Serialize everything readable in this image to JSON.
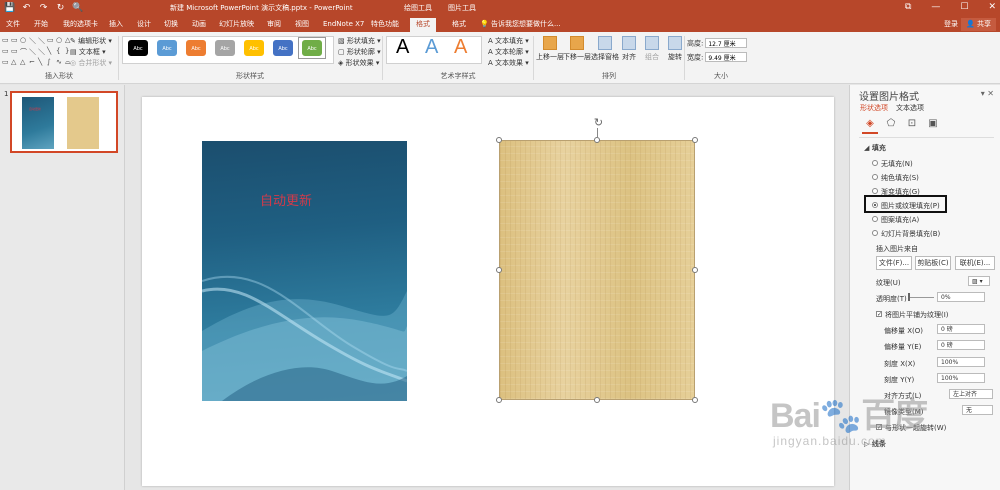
{
  "titlebar": {
    "quick_access": [
      "💾",
      "↶",
      "↷",
      "↻",
      "🔍"
    ],
    "doc_title": "新建 Microsoft PowerPoint 演示文稿.pptx - PowerPoint",
    "context_groups": [
      "绘图工具",
      "图片工具"
    ],
    "window_controls": [
      "⧉",
      "—",
      "☐",
      "✕"
    ]
  },
  "tabs": [
    {
      "label": "文件"
    },
    {
      "label": "开始"
    },
    {
      "label": "我的选项卡"
    },
    {
      "label": "插入"
    },
    {
      "label": "设计"
    },
    {
      "label": "切换"
    },
    {
      "label": "动画"
    },
    {
      "label": "幻灯片放映"
    },
    {
      "label": "审阅"
    },
    {
      "label": "视图"
    },
    {
      "label": "EndNote X7"
    },
    {
      "label": "特色功能"
    },
    {
      "label": "格式"
    },
    {
      "label": "格式"
    }
  ],
  "tellme": "💡 告诉我您想要做什么...",
  "login": "登录",
  "share": "👤 共享",
  "ribbon": {
    "insert_shapes": {
      "label": "插入形状",
      "shape_glyphs": [
        "▭",
        "▭",
        "○",
        "＼",
        "＼",
        "▭",
        "○",
        "△",
        "▭",
        "▭",
        "⌒",
        "＼",
        "＼",
        "╲",
        "{",
        "}",
        "▭",
        "△",
        "△",
        "⌐",
        "╲",
        "∫",
        "∿",
        "⌓"
      ],
      "edit_shape": "✎ 编辑形状 ▾",
      "text_box": "▤ 文本框 ▾",
      "merge_shapes": "◎ 合并形状 ▾"
    },
    "shape_styles": {
      "label": "形状样式",
      "style_items": [
        {
          "text": "Abc",
          "color": "#000000"
        },
        {
          "text": "Abc",
          "color": "#5b9bd5"
        },
        {
          "text": "Abc",
          "color": "#ed7d31"
        },
        {
          "text": "Abc",
          "color": "#a5a5a5"
        },
        {
          "text": "Abc",
          "color": "#ffc000"
        },
        {
          "text": "Abc",
          "color": "#4472c4"
        },
        {
          "text": "Abc",
          "color": "#70ad47"
        }
      ],
      "fill": "▧ 形状填充 ▾",
      "outline": "▢ 形状轮廓 ▾",
      "effects": "◈ 形状效果 ▾"
    },
    "wordart": {
      "label": "艺术字样式",
      "letters": [
        {
          "text": "A",
          "color": "#000000"
        },
        {
          "text": "A",
          "color": "#5b9bd5"
        },
        {
          "text": "A",
          "color": "#ed7d31"
        }
      ],
      "text_fill": "A 文本填充 ▾",
      "text_outline": "A 文本轮廓 ▾",
      "text_effects": "A 文本效果 ▾"
    },
    "arrange": {
      "label": "排列",
      "bring_forward": "上移一层",
      "send_backward": "下移一层",
      "selection_pane": "选择窗格",
      "align": "对齐",
      "group": "组合",
      "rotate": "旋转"
    },
    "size": {
      "label": "大小",
      "height_label": "高度:",
      "height_value": "12.7 厘米",
      "width_label": "宽度:",
      "width_value": "9.49 厘米"
    }
  },
  "slide_pane": {
    "slide_number": "1",
    "thumb_text": "自动更新"
  },
  "slide": {
    "cover_text": "自动更新",
    "cover_color": "#1f5f82",
    "paper_color": "#e3c98e"
  },
  "format_pane": {
    "title": "设置图片格式",
    "controls": "▾  ✕",
    "tabs": [
      {
        "label": "形状选项"
      },
      {
        "label": "文本选项"
      }
    ],
    "icons": [
      "◈",
      "⬠",
      "⊡",
      "▣"
    ],
    "fill_section": "◢ 填充",
    "fill_options": [
      {
        "label": "无填充(N)",
        "checked": false
      },
      {
        "label": "纯色填充(S)",
        "checked": false
      },
      {
        "label": "渐变填充(G)",
        "checked": false
      },
      {
        "label": "图片或纹理填充(P)",
        "checked": true
      },
      {
        "label": "图案填充(A)",
        "checked": false
      },
      {
        "label": "幻灯片背景填充(B)",
        "checked": false
      }
    ],
    "insert_from": "插入图片来自",
    "file_btn": "文件(F)...",
    "clipboard_btn": "剪贴板(C)",
    "online_btn": "联机(E)...",
    "texture_label": "纹理(U)",
    "transparency_label": "透明度(T)",
    "transparency_value": "0%",
    "tile_checkbox": "将图片平铺为纹理(I)",
    "offset_x_label": "偏移量 X(O)",
    "offset_x_value": "0 磅",
    "offset_y_label": "偏移量 Y(E)",
    "offset_y_value": "0 磅",
    "scale_x_label": "刻度 X(X)",
    "scale_x_value": "100%",
    "scale_y_label": "刻度 Y(Y)",
    "scale_y_value": "100%",
    "align_label": "对齐方式(L)",
    "align_value": "左上对齐",
    "mirror_label": "镜像类型(M)",
    "mirror_value": "无",
    "rotate_with_shape": "与形状一起旋转(W)",
    "line_section": "▷ 线条"
  },
  "watermark": {
    "main": "Bai🐾百度",
    "sub": "jingyan.baidu.com"
  }
}
